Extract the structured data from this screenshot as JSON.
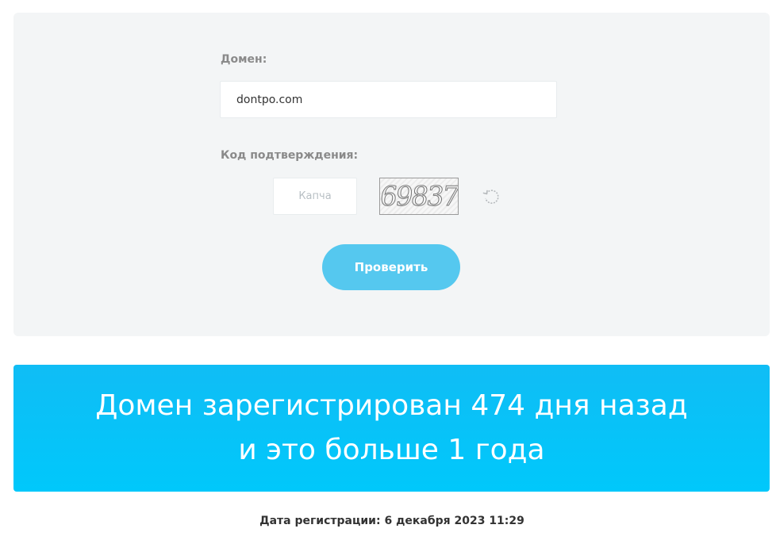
{
  "form": {
    "domain_label": "Домен:",
    "domain_value": "dontpo.com",
    "code_label": "Код подтверждения:",
    "captcha_placeholder": "Капча",
    "captcha_text": "69837",
    "check_label": "Проверить"
  },
  "result": {
    "line1": "Домен зарегистрирован 474 дня назад",
    "line2": "и это больше 1 года"
  },
  "registration": {
    "text": "Дата регистрации: 6 декабря 2023 11:29"
  },
  "colors": {
    "panel_bg": "#f3f5f6",
    "button_bg": "#55c8ef",
    "banner_bg": "#00c8fb"
  },
  "icons": {
    "refresh": "refresh-icon"
  }
}
